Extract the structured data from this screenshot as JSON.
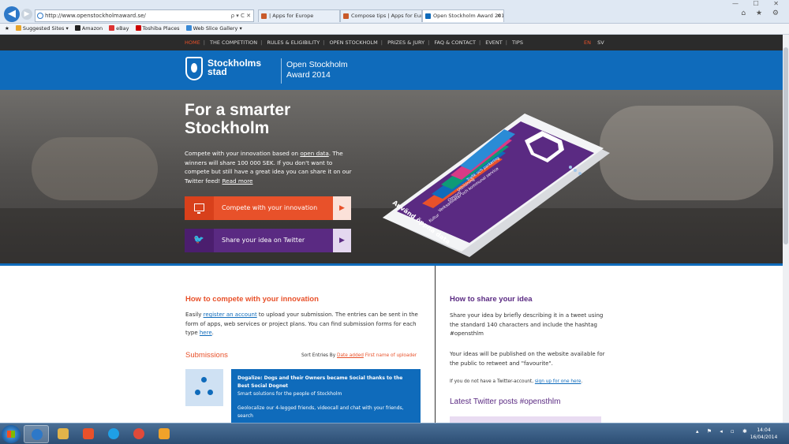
{
  "browser": {
    "address": "http://www.openstockholmaward.se/",
    "address_controls": "ρ ▾ C ✕",
    "tabs": [
      "| Apps for Europe",
      "Compose tips | Apps for Europe",
      "Open Stockholm Award 2014"
    ],
    "tab_close": "✕",
    "window_buttons": "— ☐ ✕",
    "right_icons": "⌂ ★ ⚙",
    "favorites": [
      "Suggested Sites ▾",
      "Amazon",
      "eBay",
      "Toshiba Places",
      "Web Slice Gallery ▾"
    ]
  },
  "site_nav": {
    "links": [
      "HOME",
      "THE COMPETITION",
      "RULES & ELIGIBILITY",
      "OPEN STOCKHOLM",
      "PRIZES & JURY",
      "FAQ & CONTACT",
      "EVENT",
      "TIPS"
    ],
    "separator": "|",
    "lang_en": "EN",
    "lang_sv": "SV"
  },
  "banner": {
    "logo_line1": "Stockholms",
    "logo_line2": "stad",
    "award_line1": "Open Stockholm",
    "award_line2": "Award 2014"
  },
  "hero": {
    "title": "For a smarter Stockholm",
    "desc_1": "Compete with your innovation based on ",
    "desc_link": "open data",
    "desc_2": ". The winners will share 100 000 SEK. If you don't want to compete but still have a great idea you can share it on our Twitter feed! ",
    "desc_read_more": "Read more",
    "cta_compete": "Compete with your innovation",
    "cta_share": "Share your idea on Twitter",
    "arrow": "▶",
    "twitter_glyph": "🐦",
    "phone_caption": "Använd öppna data",
    "phone_tiles": [
      "Trafik och parkering",
      "Utbildning",
      "Omsorg",
      "Verksamheter och kommunal service",
      "Kultur"
    ]
  },
  "left": {
    "heading": "How to compete with your innovation",
    "p_1": "Easily ",
    "p_link": "register an account",
    "p_2": " to upload your submission. The entries can be sent in the form of apps, web services or project plans. You can find submission forms for each type ",
    "p_here": "here",
    "p_3": ".",
    "submissions": "Submissions",
    "sort_label": "Sort Entries By ",
    "sort_date": "Date added",
    "sort_name": "First name of uploader",
    "entry_title": "Dogalize: Dogs and their Owners became Social thanks to the Best Social Dognet",
    "entry_sub": "Smart solutions for the people of Stockholm",
    "entry_body": "Geolocalize our 4-legged friends, videocall and chat with your friends, search"
  },
  "right": {
    "heading": "How to share your idea",
    "p1": "Share your idea by briefly describing it in a tweet using the standard 140 characters and include the hashtag #opensthlm",
    "p2": "Your ideas will be published on the website available for the public to retweet and \"favourite\".",
    "small_1": "If you do not have a Twitter-account, ",
    "small_link": "sign up for one here",
    "small_2": ".",
    "twitter_heading": "Latest Twitter posts #opensthlm"
  },
  "taskbar": {
    "tray": "▴ ⚑ ◂ ▫ ✱",
    "time": "14:04",
    "date": "16/04/2014"
  },
  "colors": {
    "accent_orange": "#e8512a",
    "accent_blue": "#0f6bbb",
    "accent_purple": "#5a2a82"
  },
  "icons": [
    "back-arrow-icon",
    "forward-arrow-icon",
    "home-icon",
    "star-icon",
    "gear-icon",
    "monitor-icon",
    "twitter-bird-icon",
    "play-arrow-icon",
    "windows-start-icon"
  ]
}
